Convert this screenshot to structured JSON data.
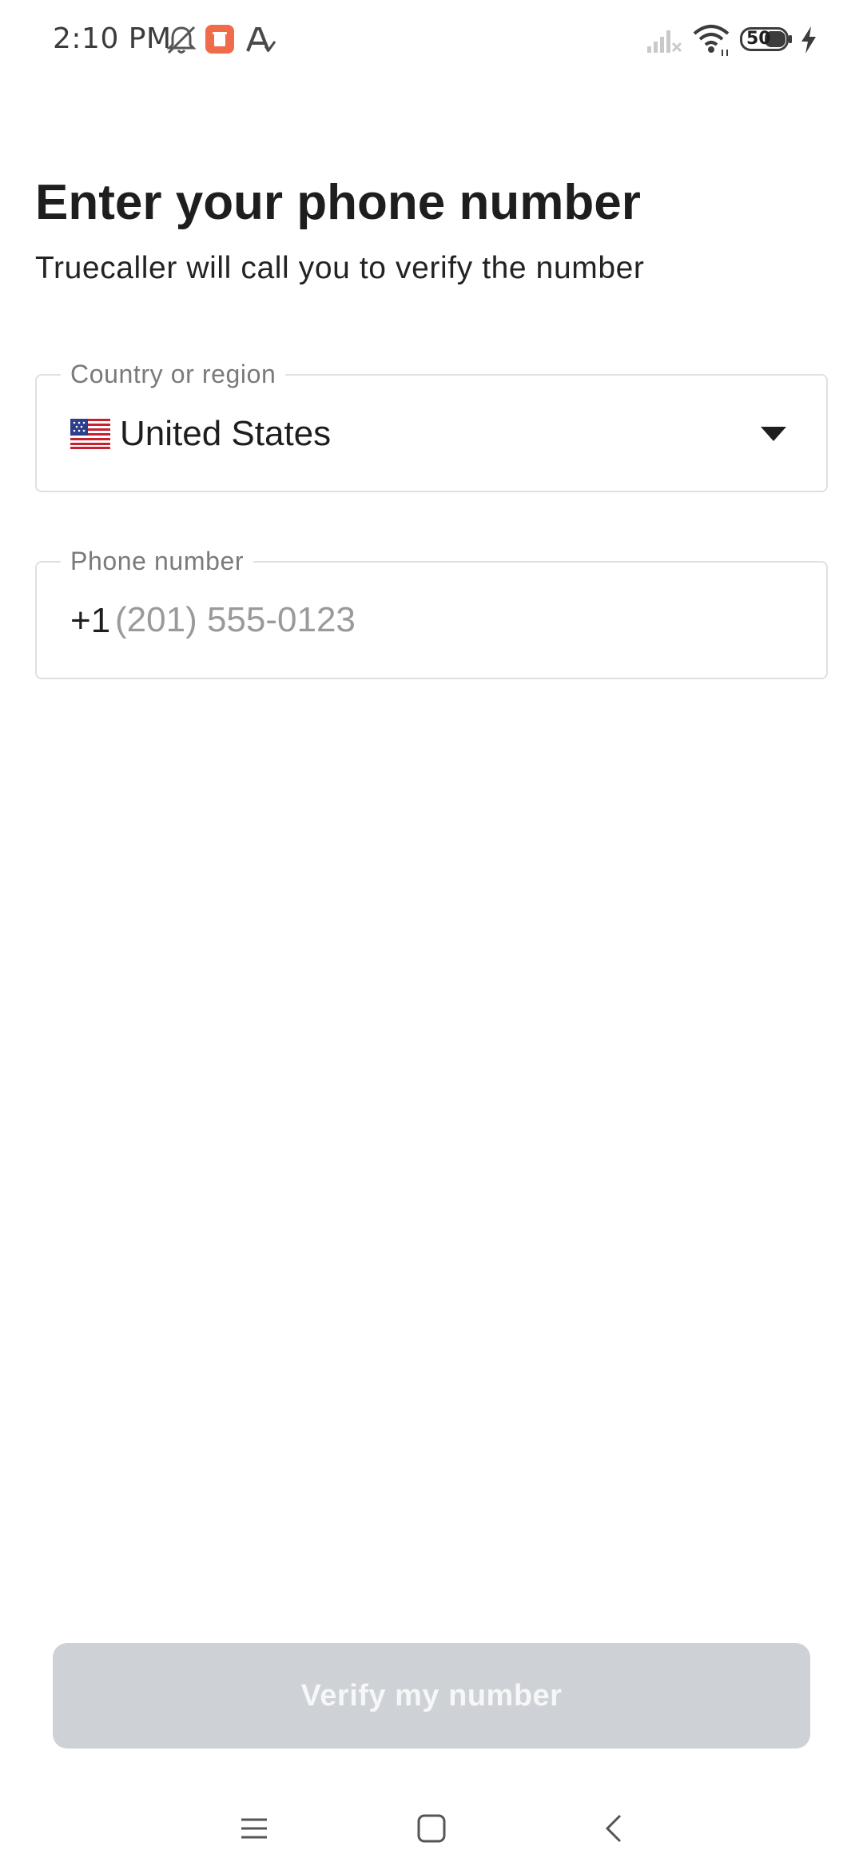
{
  "status_bar": {
    "time": "2:10 PM",
    "battery_level": "50",
    "icons": [
      "bell-muted-icon",
      "app-notification-icon",
      "font-app-icon",
      "signal-icon",
      "wifi-icon",
      "battery-icon",
      "charging-icon"
    ],
    "notification_icon_color": "#f06b4a"
  },
  "page": {
    "title": "Enter your phone number",
    "subtitle": "Truecaller will call you to verify the number"
  },
  "country_field": {
    "label": "Country or region",
    "value": "United States",
    "flag": "us-flag-icon"
  },
  "phone_field": {
    "label": "Phone number",
    "country_code": "+1",
    "placeholder": "(201) 555-0123",
    "value": ""
  },
  "actions": {
    "verify_label": "Verify my number",
    "verify_enabled": false,
    "button_color": "#ced1d6"
  },
  "nav_bar": {
    "icons": [
      "menu-icon",
      "home-icon",
      "back-icon"
    ]
  }
}
